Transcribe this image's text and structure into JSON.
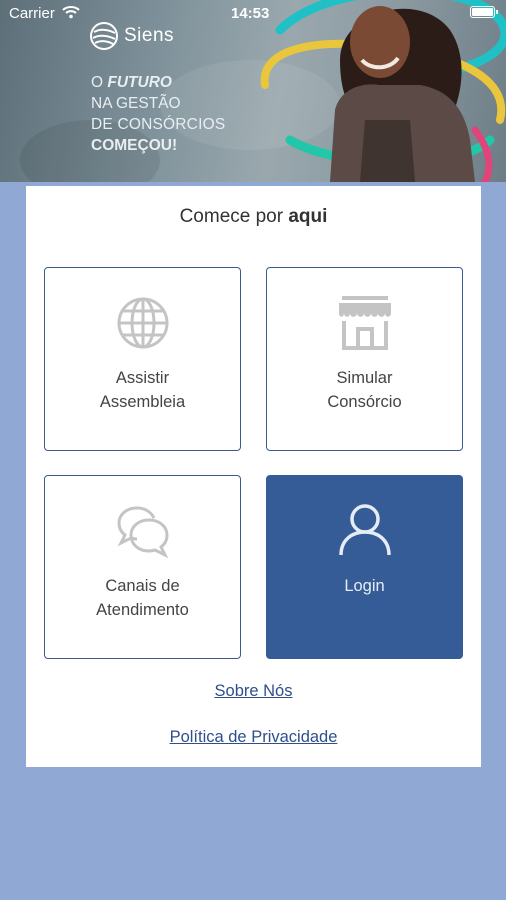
{
  "status_bar": {
    "carrier": "Carrier",
    "time": "14:53"
  },
  "banner": {
    "brand": "Siens",
    "tagline_prefix": "O ",
    "tagline_emphasis": "FUTURO",
    "tagline_line2": "NA GESTÃO",
    "tagline_line3": "DE CONSÓRCIOS",
    "tagline_line4": "COMEÇOU!"
  },
  "card": {
    "heading_prefix": "Comece por ",
    "heading_bold": "aqui",
    "tiles": [
      {
        "label_line1": "Assistir",
        "label_line2": "Assembleia",
        "icon": "globe-icon"
      },
      {
        "label_line1": "Simular",
        "label_line2": "Consórcio",
        "icon": "storefront-icon"
      },
      {
        "label_line1": "Canais de",
        "label_line2": "Atendimento",
        "icon": "chat-bubbles-icon"
      },
      {
        "label_line1": "Login",
        "icon": "user-icon"
      }
    ],
    "links": {
      "about": "Sobre Nós",
      "privacy": "Política de Privacidade"
    }
  },
  "colors": {
    "page_background": "#8fa9d4",
    "accent": "#365c97",
    "link": "#2e4f8c"
  }
}
